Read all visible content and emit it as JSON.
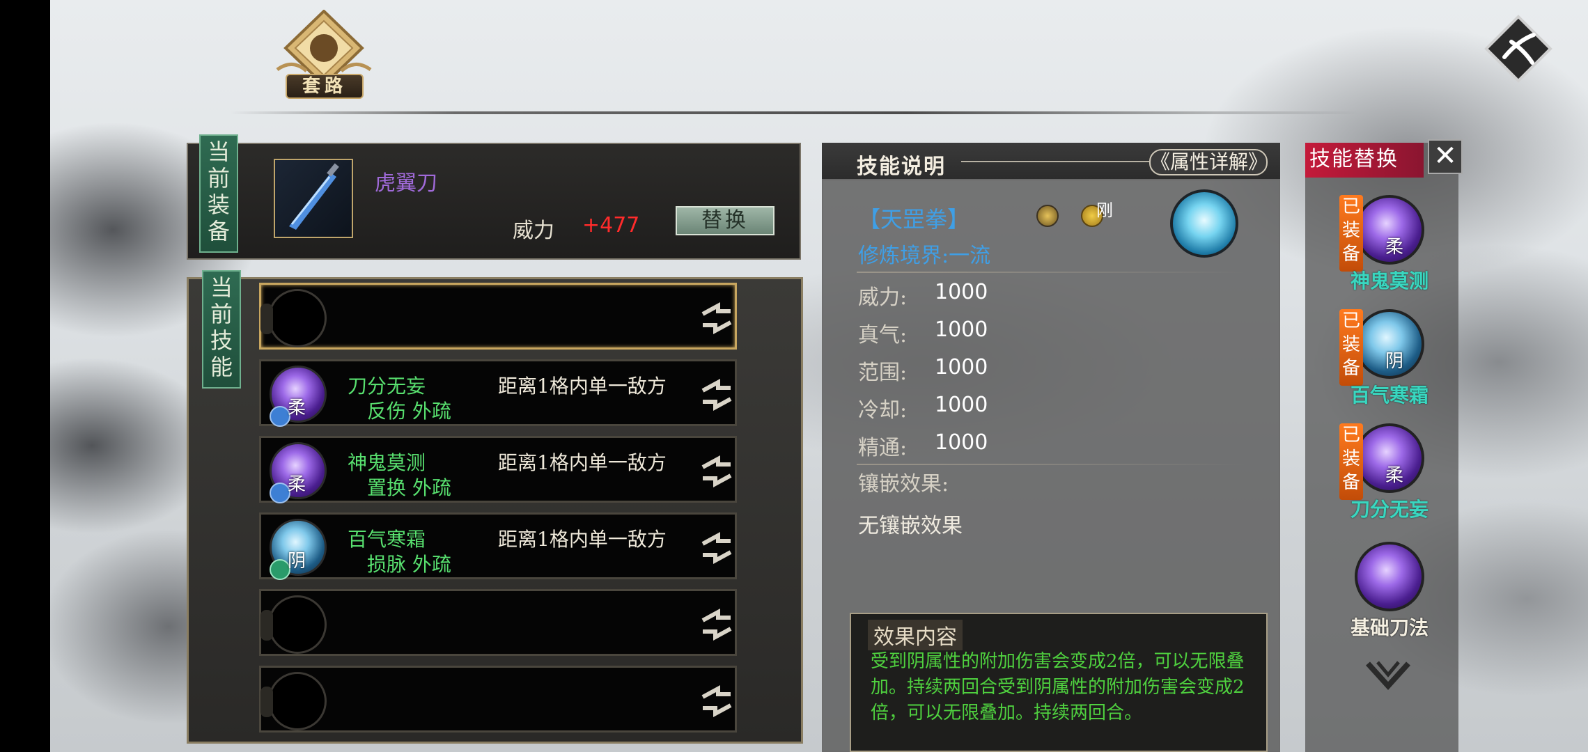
{
  "header": {
    "title": "套路"
  },
  "equipment": {
    "tag": "当前装备",
    "name": "虎翼刀",
    "power_label": "威力",
    "power_value": "+477",
    "replace_label": "替换"
  },
  "skills": {
    "tag": "当前技能",
    "slots": [
      {
        "empty": true
      },
      {
        "name": "刀分无妄",
        "traits": "反伤 外疏",
        "range": "距离1格内单一敌方",
        "orb": "purple",
        "tag": "柔"
      },
      {
        "name": "神鬼莫测",
        "traits": "置换 外疏",
        "range": "距离1格内单一敌方",
        "orb": "purple",
        "tag": "柔"
      },
      {
        "name": "百气寒霜",
        "traits": "损脉 外疏",
        "range": "距离1格内单一敌方",
        "orb": "blue",
        "tag": "阴"
      },
      {
        "empty": true
      },
      {
        "empty": true
      }
    ]
  },
  "description": {
    "title": "技能说明",
    "attr_button": "《属性详解》",
    "skill_name": "【天罡拳】",
    "type_tag": "刚",
    "realm": "修炼境界:一流",
    "stats": [
      {
        "label": "威力:",
        "value": "1000"
      },
      {
        "label": "真气:",
        "value": "1000"
      },
      {
        "label": "范围:",
        "value": "1000"
      },
      {
        "label": "冷却:",
        "value": "1000"
      },
      {
        "label": "精通:",
        "value": "1000"
      }
    ],
    "inlay_label": "镶嵌效果:",
    "inlay_value": "无镶嵌效果",
    "effect_title": "效果内容",
    "effect_text": "受到阴属性的附加伤害会变成2倍，可以无限叠加。持续两回合受到阴属性的附加伤害会变成2倍，可以无限叠加。持续两回合。"
  },
  "replace_panel": {
    "title": "技能替换",
    "close": "✕",
    "items": [
      {
        "name": "神鬼莫测",
        "equipped": "已装备",
        "tag": "柔",
        "orb": "purple"
      },
      {
        "name": "百气寒霜",
        "equipped": "已装备",
        "tag": "阴",
        "orb": "blue"
      },
      {
        "name": "刀分无妄",
        "equipped": "已装备",
        "tag": "柔",
        "orb": "purple"
      },
      {
        "name": "基础刀法",
        "equipped": "",
        "tag": "",
        "orb": "purple"
      }
    ]
  },
  "colors": {
    "accent_green": "#58e06f",
    "accent_blue": "#3f9fe6",
    "power_red": "#ff2b2b",
    "replace_header_red": "#c41a3a",
    "equipped_orange": "#ff7a1e"
  }
}
